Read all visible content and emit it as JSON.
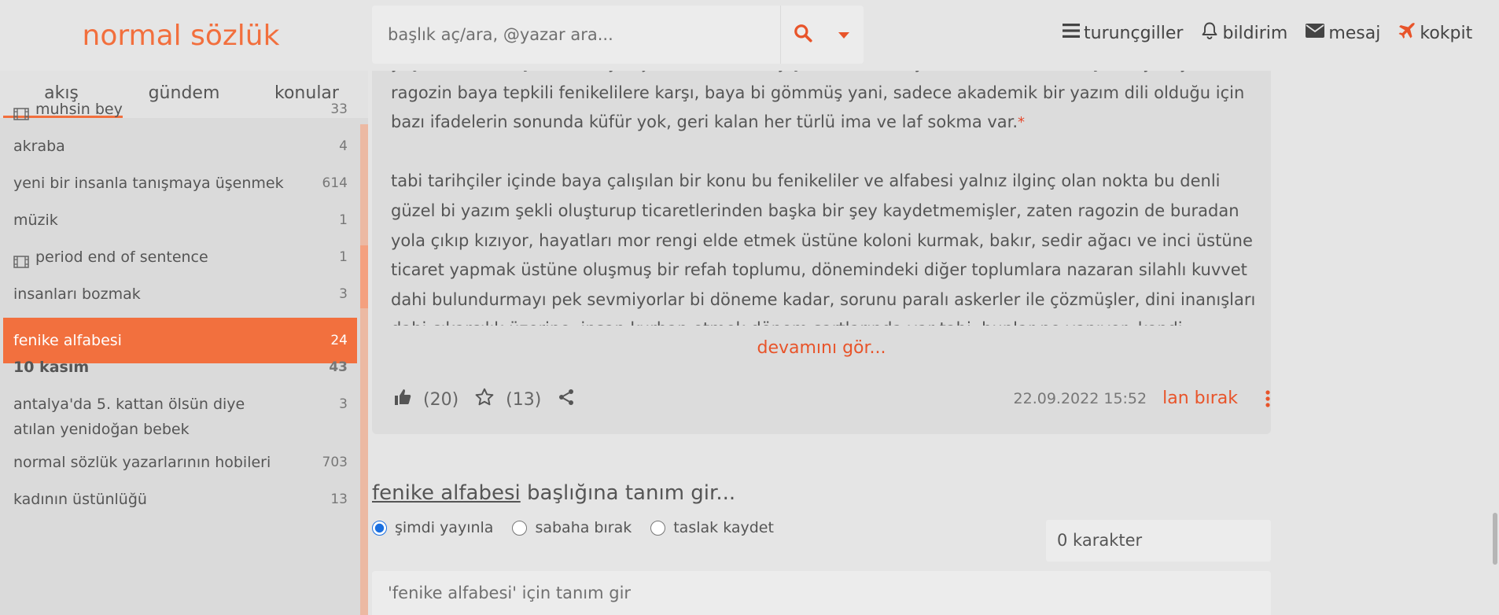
{
  "header": {
    "logo": "normal sözlük",
    "search_placeholder": "başlık aç/ara, @yazar ara...",
    "nav": [
      {
        "label": "turunçgiller",
        "icon": "menu-icon"
      },
      {
        "label": "bildirim",
        "icon": "bell-icon"
      },
      {
        "label": "mesaj",
        "icon": "envelope-icon"
      },
      {
        "label": "kokpit",
        "icon": "plane-icon"
      }
    ]
  },
  "sidebar": {
    "tabs": [
      "akış",
      "gündem",
      "konular"
    ],
    "active_tab": "akış",
    "topics": [
      {
        "name": "muhsin bey",
        "count": "33",
        "film": true
      },
      {
        "name": "akraba",
        "count": "4"
      },
      {
        "name": "yeni bir insanla tanışmaya üşenmek",
        "count": "614"
      },
      {
        "name": "müzik",
        "count": "1"
      },
      {
        "name": "period end of sentence",
        "count": "1",
        "film": true
      },
      {
        "name": "insanları bozmak",
        "count": "3"
      },
      {
        "name": "fenike alfabesi",
        "count": "24",
        "active": true
      },
      {
        "name": "10 kasım",
        "count": "43",
        "bold": true
      },
      {
        "name": "antalya'da 5. kattan ölsün diye atılan yenidoğan bebek",
        "count": "3"
      },
      {
        "name": "normal sözlük yazarlarının hobileri",
        "count": "703"
      },
      {
        "name": "kadının üstünlüğü",
        "count": "13"
      }
    ]
  },
  "entry": {
    "paragraph1": "yaşamı, ticari ilişkileri, sosyolojisi ve ticari anlayışları üstüne baya bi not var, ama baştan uyarayım ragozin baya tepkili fenikelilere karşı, baya bi gömmüş yani, sadece akademik bir yazım dili olduğu için bazı ifadelerin sonunda küfür yok, geri kalan her türlü ima ve laf sokma var.",
    "paragraph1_mark": "*",
    "paragraph2": "tabi tarihçiler içinde baya çalışılan bir konu bu fenikeliler ve alfabesi yalnız ilginç olan nokta bu denli güzel bi yazım şekli oluşturup ticaretlerinden başka bir şey kaydetmemişler, zaten ragozin de buradan yola çıkıp kızıyor, hayatları mor rengi elde etmek üstüne koloni kurmak, bakır, sedir ağacı ve inci üstüne ticaret yapmak üstüne oluşmuş bir refah toplumu, dönemindeki diğer toplumlara nazaran silahlı kuvvet dahi bulundurmayı pek sevmiyorlar bi döneme kadar, sorunu paralı askerler ile çözmüşler, dini inanışları dahi çıkarcılık üzerine, insan kurban etmek dönem şartlarında var tabi, bunlar ne yapıyor, kendi çocuğunu",
    "more_label": "devamını gör...",
    "likes": "(20)",
    "favorites": "(13)",
    "date": "22.09.2022 15:52",
    "author": "lan bırak"
  },
  "compose": {
    "topic_link": "fenike alfabesi",
    "title_suffix": " başlığına tanım gir...",
    "options": [
      "şimdi yayınla",
      "sabaha bırak",
      "taslak kaydet"
    ],
    "selected_option": "şimdi yayınla",
    "char_count": "0 karakter",
    "textarea_placeholder": "'fenike alfabesi' için tanım gir"
  },
  "colors": {
    "accent": "#f26f3d",
    "link": "#e8542a",
    "background": "#e5e5e5",
    "sidebar_bg": "#dadada"
  }
}
